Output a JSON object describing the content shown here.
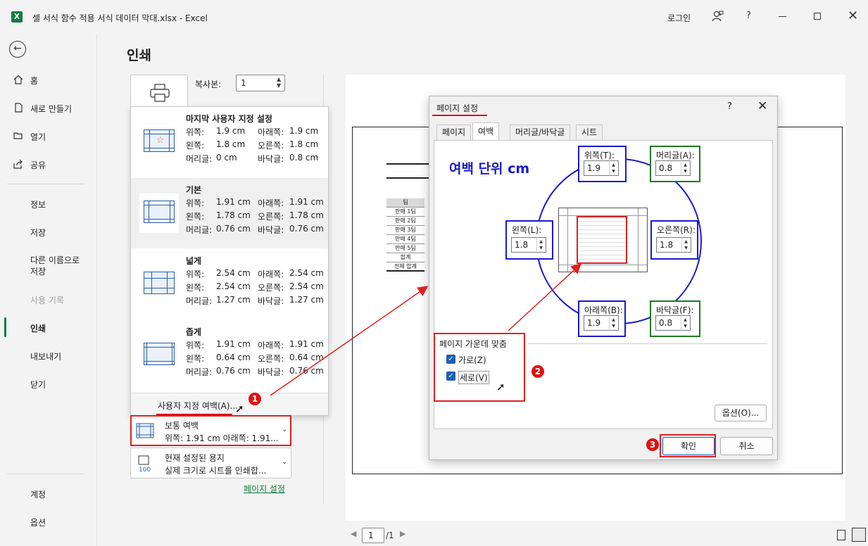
{
  "window": {
    "title": "셀 서식 함수 적용 서식 데이터 막대.xlsx  -  Excel",
    "app_letter": "X",
    "login": "로그인",
    "help": "?"
  },
  "sidebar": {
    "items": [
      {
        "label": "홈",
        "icon": "home-icon"
      },
      {
        "label": "새로 만들기",
        "icon": "new-file-icon"
      },
      {
        "label": "열기",
        "icon": "folder-open-icon"
      },
      {
        "label": "공유",
        "icon": "share-icon"
      },
      {
        "label": "정보"
      },
      {
        "label": "저장"
      },
      {
        "label": "다른 이름으로\n저장"
      },
      {
        "label": "사용 기록"
      },
      {
        "label": "인쇄"
      },
      {
        "label": "내보내기"
      },
      {
        "label": "닫기"
      },
      {
        "label": "계정"
      },
      {
        "label": "옵션"
      }
    ],
    "active": "인쇄",
    "disabled": "사용 기록"
  },
  "print": {
    "title": "인쇄",
    "copies_label": "복사본:",
    "copies_value": "1",
    "page_setup_link": "페이지 설정"
  },
  "margin_menu": {
    "presets": [
      {
        "name": "마지막 사용자 지정 설정",
        "top_label": "위쪽:",
        "top": "1.9 cm",
        "bottom_label": "아래쪽:",
        "bottom": "1.9 cm",
        "left_label": "왼쪽:",
        "left": "1.8 cm",
        "right_label": "오른쪽:",
        "right": "1.8 cm",
        "header_label": "머리글:",
        "header": "0 cm",
        "footer_label": "바닥글:",
        "footer": "0.8 cm"
      },
      {
        "name": "기본",
        "top_label": "위쪽:",
        "top": "1.91 cm",
        "bottom_label": "아래쪽:",
        "bottom": "1.91 cm",
        "left_label": "왼쪽:",
        "left": "1.78 cm",
        "right_label": "오른쪽:",
        "right": "1.78 cm",
        "header_label": "머리글:",
        "header": "0.76 cm",
        "footer_label": "바닥글:",
        "footer": "0.76 cm"
      },
      {
        "name": "넓게",
        "top_label": "위쪽:",
        "top": "2.54 cm",
        "bottom_label": "아래쪽:",
        "bottom": "2.54 cm",
        "left_label": "왼쪽:",
        "left": "2.54 cm",
        "right_label": "오른쪽:",
        "right": "2.54 cm",
        "header_label": "머리글:",
        "header": "1.27 cm",
        "footer_label": "바닥글:",
        "footer": "1.27 cm"
      },
      {
        "name": "좁게",
        "top_label": "위쪽:",
        "top": "1.91 cm",
        "bottom_label": "아래쪽:",
        "bottom": "1.91 cm",
        "left_label": "왼쪽:",
        "left": "0.64 cm",
        "right_label": "오른쪽:",
        "right": "0.64 cm",
        "header_label": "머리글:",
        "header": "0.76 cm",
        "footer_label": "바닥글:",
        "footer": "0.76 cm"
      }
    ],
    "custom_margins": "사용자 지정 여백(A)..."
  },
  "settings": {
    "margins_line1": "보통 여백",
    "margins_line2": "위쪽: 1.91 cm 아래쪽: 1.91...",
    "paper_line1": "현재 설정된 용지",
    "paper_line2": "실제 크기로 시트를 인쇄합...",
    "paper_icon_text": "100"
  },
  "preview": {
    "table_header": "팀",
    "table_rows": [
      "판매 1팀",
      "판매 2팀",
      "판매 3팀",
      "판매 4팀",
      "판매 5팀",
      "합계",
      "전체 합계"
    ],
    "page_current": "1",
    "page_total": "/1"
  },
  "dialog": {
    "title": "페이지 설정",
    "help": "?",
    "tabs": [
      "페이지",
      "여백",
      "머리글/바닥글",
      "시트"
    ],
    "active_tab": "여백",
    "unit_note": "여백 단위 cm",
    "fields": {
      "top": {
        "label": "위쪽(T):",
        "value": "1.9"
      },
      "header": {
        "label": "머리글(A):",
        "value": "0.8"
      },
      "left": {
        "label": "왼쪽(L):",
        "value": "1.8"
      },
      "right": {
        "label": "오른쪽(R):",
        "value": "1.8"
      },
      "bottom": {
        "label": "아래쪽(B):",
        "value": "1.9"
      },
      "footer": {
        "label": "바닥글(F):",
        "value": "0.8"
      }
    },
    "center_title": "페이지 가운데 맞춤",
    "horizontally": "가로(Z)",
    "vertically": "세로(V)",
    "horizontally_checked": true,
    "vertically_checked": true,
    "options_btn": "옵션(O)...",
    "ok_btn": "확인",
    "cancel_btn": "취소"
  },
  "annotations": {
    "badge1": "1",
    "badge2": "2",
    "badge3": "3",
    "accent_color": "#e02020"
  }
}
